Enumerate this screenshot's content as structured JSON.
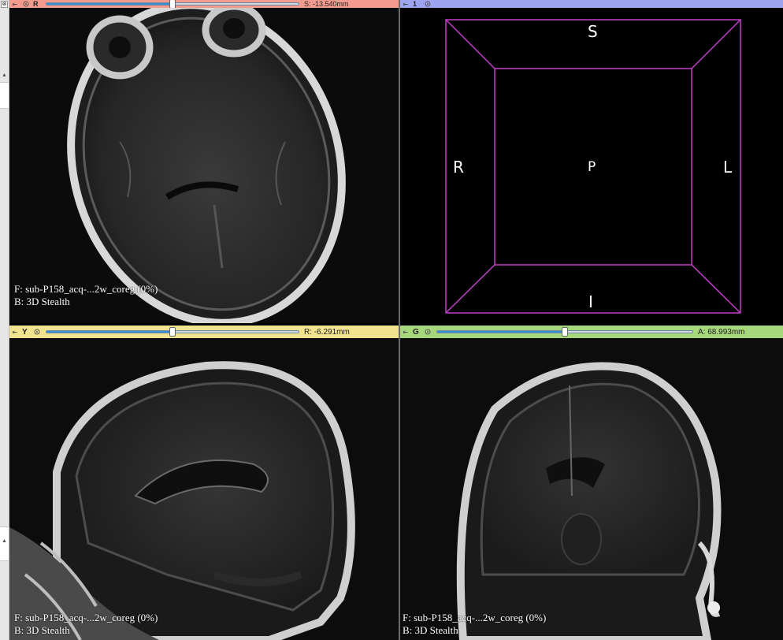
{
  "views": {
    "red": {
      "letter": "R",
      "offset_label": "S: -13.540mm",
      "slider_fraction": 0.5,
      "foreground": "F: sub-P158_acq-...2w_coreg (0%)",
      "background": "B: 3D Stealth",
      "color": "#f39b8e"
    },
    "threed": {
      "label": "1",
      "orientation": {
        "top": "S",
        "bottom": "I",
        "left": "R",
        "right": "L",
        "center": "P"
      },
      "box_color": "#c23fc9",
      "color": "#9ea4ef"
    },
    "yellow": {
      "letter": "Y",
      "offset_label": "R: -6.291mm",
      "slider_fraction": 0.5,
      "foreground": "F: sub-P158_acq-...2w_coreg (0%)",
      "background": "B: 3D Stealth",
      "color": "#f2e38e"
    },
    "green": {
      "letter": "G",
      "offset_label": "A: 68.993mm",
      "slider_fraction": 0.5,
      "foreground": "F: sub-P158_acq-...2w_coreg (0%)",
      "background": "B: 3D Stealth",
      "color": "#a6d77a"
    }
  }
}
